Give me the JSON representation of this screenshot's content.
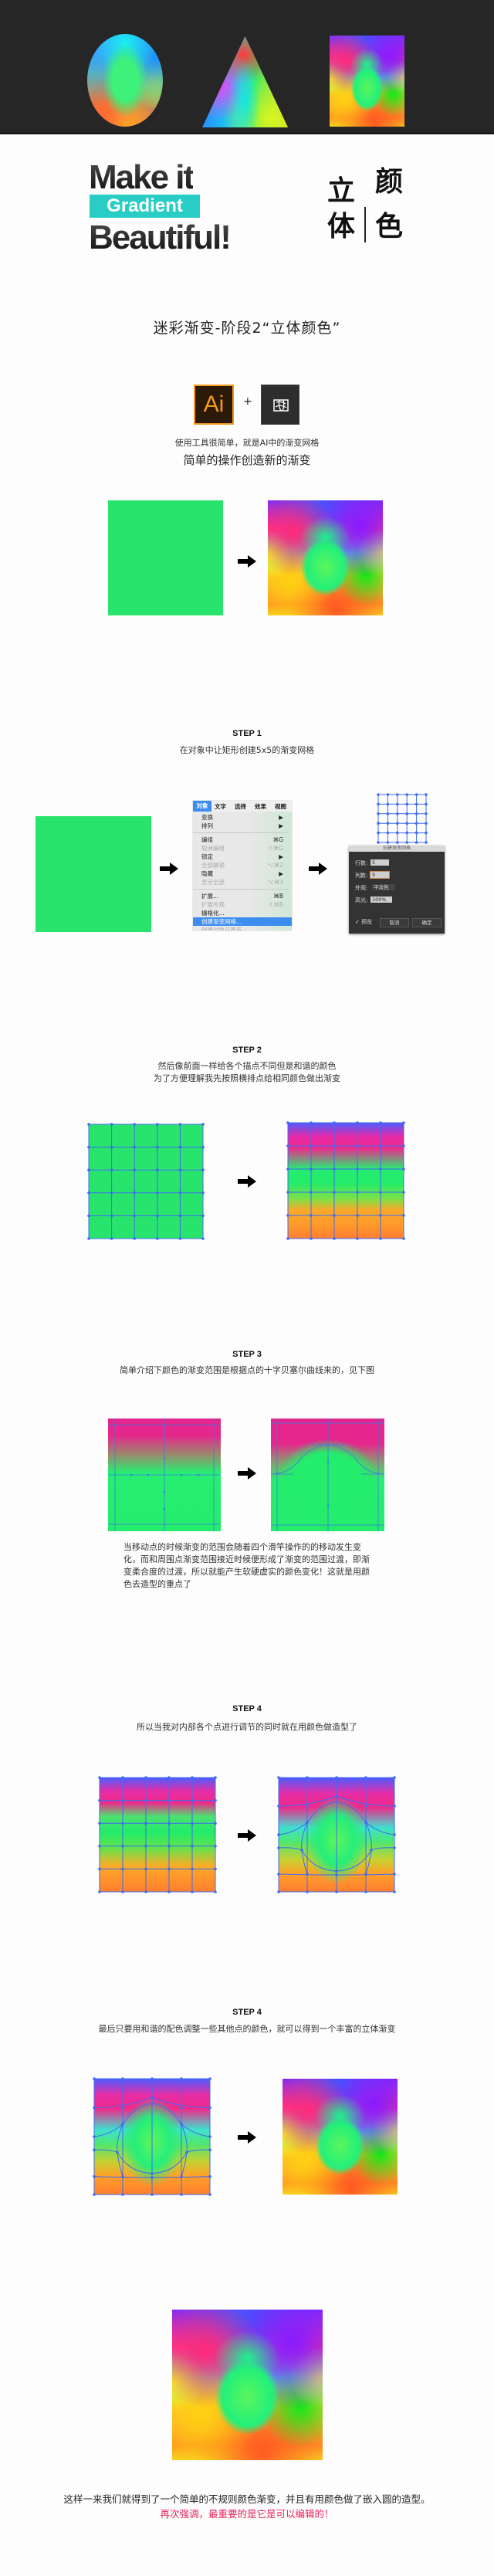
{
  "hero": {
    "shapes": [
      "gradient-ellipse",
      "gradient-triangle",
      "gradient-square"
    ]
  },
  "title": {
    "line1": "Make it",
    "badge": "Gradient",
    "line2": "Beautiful!",
    "cn_left": [
      "立",
      "体"
    ],
    "cn_right": [
      "颜",
      "色"
    ],
    "badge_color": "#29cdc6"
  },
  "subtitle": "迷彩渐变-阶段2“立体颜色”",
  "intro": {
    "ai_label": "Ai",
    "plus": "+",
    "mesh_tool": "gradient-mesh-tool-icon",
    "line1": "使用工具很简单，就是AI中的渐变网格",
    "line2": "简单的操作创造新的渐变"
  },
  "steps": {
    "step1": {
      "label": "STEP 1",
      "desc": "在对象中让矩形创建5x5的渐变网格",
      "menu": {
        "bar": [
          "对象",
          "文字",
          "选择",
          "效果",
          "视图"
        ],
        "items": [
          {
            "label": "变换",
            "shortcut": "▶",
            "disabled": false
          },
          {
            "label": "排列",
            "shortcut": "▶",
            "disabled": false
          },
          {
            "label": "编组",
            "shortcut": "⌘G",
            "disabled": false
          },
          {
            "label": "取消编组",
            "shortcut": "⇧⌘G",
            "disabled": true
          },
          {
            "label": "锁定",
            "shortcut": "▶",
            "disabled": false
          },
          {
            "label": "全部解锁",
            "shortcut": "⌥⌘2",
            "disabled": true
          },
          {
            "label": "隐藏",
            "shortcut": "▶",
            "disabled": false
          },
          {
            "label": "显示全部",
            "shortcut": "⌥⌘3",
            "disabled": true
          },
          {
            "label": "扩展...",
            "shortcut": "⌘B",
            "disabled": false
          },
          {
            "label": "扩展外观",
            "shortcut": "⇧⌘B",
            "disabled": true
          },
          {
            "label": "栅格化...",
            "shortcut": "",
            "disabled": false
          },
          {
            "label": "创建渐变网格...",
            "shortcut": "",
            "disabled": false,
            "selected": true
          },
          {
            "label": "创建对象马赛克...",
            "shortcut": "",
            "disabled": true
          }
        ]
      },
      "dialog": {
        "title": "创建渐变网格",
        "rows_label": "行数:",
        "rows_value": "5",
        "cols_label": "列数:",
        "cols_value": "5",
        "appearance_label": "外观:",
        "appearance_value": "平淡色",
        "highlight_label": "高光:",
        "highlight_value": "100%",
        "preview_label": "✓ 预览",
        "cancel_label": "取消",
        "ok_label": "确定"
      }
    },
    "step2": {
      "label": "STEP 2",
      "desc_line1": "然后像前面一样给各个描点不同但是和谐的颜色",
      "desc_line2": "为了方便理解我先按照横排点给相同颜色做出渐变"
    },
    "step3": {
      "label": "STEP 3",
      "desc": "简单介绍下颜色的渐变范围是根据点的十字贝塞尔曲线来的，见下图",
      "paragraph": "当移动点的时候渐变的范围会随着四个滑竿操作的的移动发生变化，而和周围点渐变范围接近时候便形成了渐变的范围过渡，即渐变柔合度的过渡，所以就能产生软硬虚实的颜色变化！这就是用颜色去造型的重点了"
    },
    "step4": {
      "label": "STEP 4",
      "desc": "所以当我对内部各个点进行调节的同时就在用颜色做造型了"
    },
    "step5": {
      "label": "STEP 4",
      "desc": "最后只要用和谐的配色调整一些其他点的颜色，就可以得到一个丰富的立体渐变"
    }
  },
  "conclusion": {
    "line1": "这样一来我们就得到了一个简单的不规则颜色渐变，并且有用颜色做了嵌入圆的造型。",
    "line2": "再次强调，最重要的是它是可以编辑的！",
    "emphasis_color": "#e8245a"
  },
  "colors": {
    "base_green": "#28e46c",
    "mesh_line": "#3f6cf0",
    "hero_bg": "#262626"
  }
}
